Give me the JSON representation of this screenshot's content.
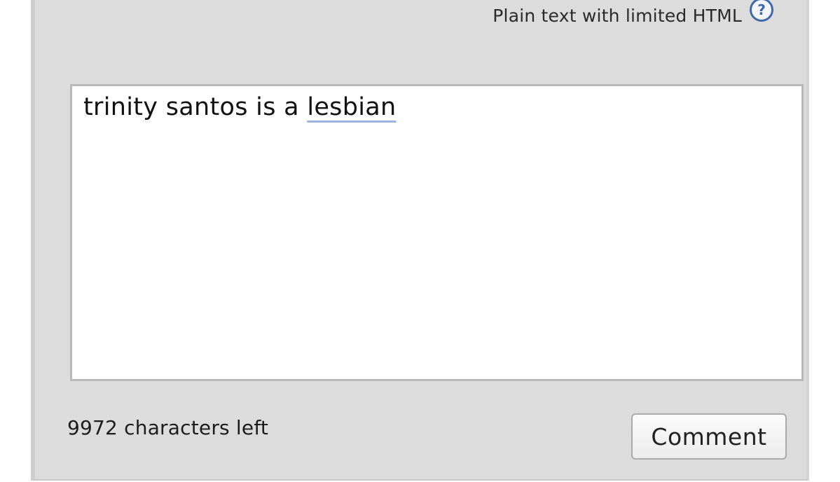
{
  "editor": {
    "format_hint": "Plain text with limited HTML",
    "help_icon_symbol": "?",
    "help_icon_name": "help-question-icon",
    "comment_text_plain": "trinity santos is a ",
    "comment_text_flagged": "lesbian",
    "characters_left": "9972 characters left",
    "submit_label": "Comment"
  },
  "colors": {
    "panel_background": "#dcdcdc",
    "help_icon": "#3d6aa8",
    "spellcheck_underline": "#9bb3e0"
  }
}
